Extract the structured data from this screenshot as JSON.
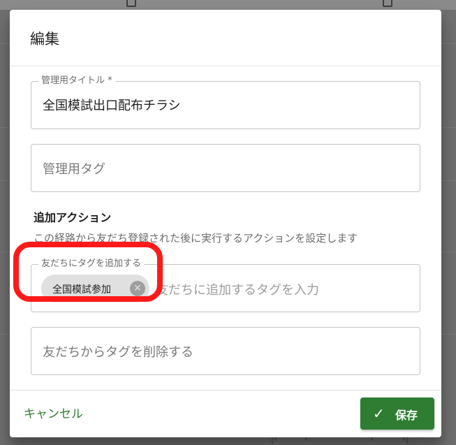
{
  "dialog": {
    "title": "編集"
  },
  "fields": {
    "admin_title": {
      "label": "管理用タイトル *",
      "value": "全国模試出口配布チラシ"
    },
    "admin_tag": {
      "placeholder": "管理用タグ"
    }
  },
  "additional_actions": {
    "heading": "追加アクション",
    "description": "この経路から友だち登録された後に実行するアクションを設定します",
    "add_tag": {
      "label": "友だちにタグを追加する",
      "chips": [
        "全国模試参加"
      ],
      "placeholder": "友だちに追加するタグを入力"
    },
    "remove_tag": {
      "placeholder": "友だちからタグを削除する"
    }
  },
  "footer": {
    "cancel_label": "キャンセル",
    "save_label": "保存"
  },
  "colors": {
    "primary": "#2e7d32",
    "highlight": "#ff1a1a",
    "chip_bg": "#e0e0e0"
  }
}
